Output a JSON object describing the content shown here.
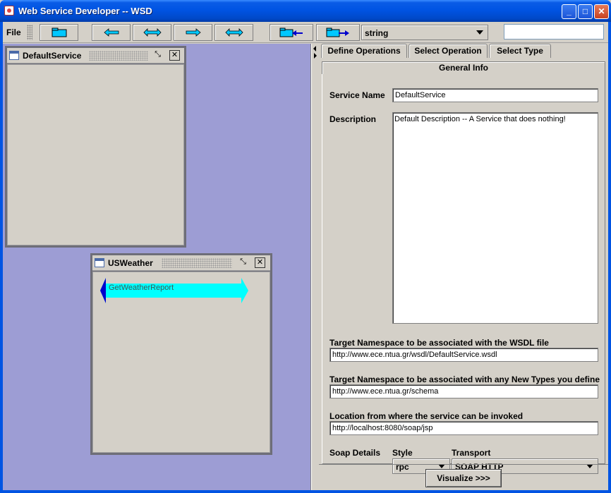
{
  "window": {
    "title": "Web Service Developer -- WSD"
  },
  "menu": {
    "file": "File"
  },
  "toolbar": {
    "type_select": "string",
    "search_value": ""
  },
  "desktop": {
    "frames": [
      {
        "title": "DefaultService"
      },
      {
        "title": "USWeather",
        "operation": "GetWeatherReport"
      }
    ]
  },
  "tabs": {
    "row1": [
      "Define Operations",
      "Select Operation",
      "Select Type"
    ],
    "active": "General Info"
  },
  "general_info": {
    "service_name_label": "Service Name",
    "service_name_value": "DefaultService",
    "description_label": "Description",
    "description_value": "Default Description -- A Service that does nothing!",
    "wsdl_ns_label": "Target Namespace to be associated with the WSDL file",
    "wsdl_ns_value": "http://www.ece.ntua.gr/wsdl/DefaultService.wsdl",
    "types_ns_label": "Target Namespace to be associated with any New Types you define",
    "types_ns_value": "http://www.ece.ntua.gr/schema",
    "location_label": "Location from where the service can be invoked",
    "location_value": "http://localhost:8080/soap/jsp",
    "soap_details_label": "Soap Details",
    "style_label": "Style",
    "style_value": "rpc",
    "transport_label": "Transport",
    "transport_value": "SOAP HTTP"
  },
  "visualize_button": "Visualize >>>",
  "colors": {
    "desktop_bg": "#9d9dd4",
    "arrow_fill": "#00ffff",
    "arrow_head": "#0000cc"
  }
}
